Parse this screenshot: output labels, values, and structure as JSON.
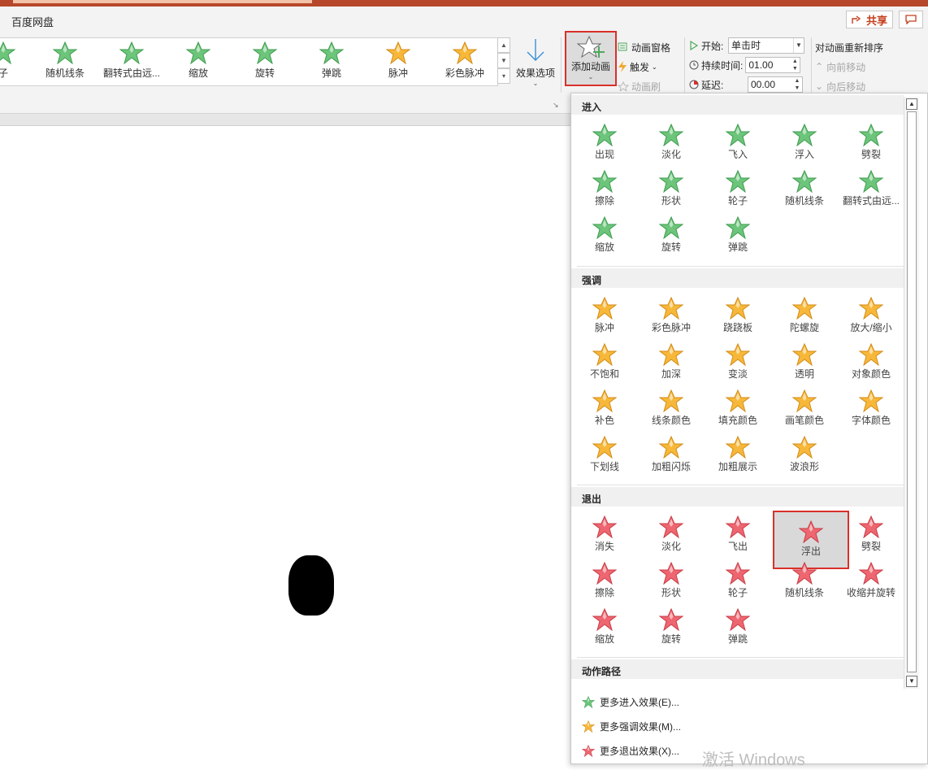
{
  "ribbon": {
    "tab_label": "百度网盘",
    "share_label": "共享",
    "gallery": [
      {
        "label": "子",
        "color": "green"
      },
      {
        "label": "随机线条",
        "color": "green"
      },
      {
        "label": "翻转式由远...",
        "color": "green"
      },
      {
        "label": "缩放",
        "color": "green"
      },
      {
        "label": "旋转",
        "color": "green"
      },
      {
        "label": "弹跳",
        "color": "green"
      },
      {
        "label": "脉冲",
        "color": "gold"
      },
      {
        "label": "彩色脉冲",
        "color": "gold"
      }
    ],
    "effect_options_label": "效果选项",
    "add_animation_label": "添加动画",
    "animation_pane_label": "动画窗格",
    "trigger_label": "触发",
    "anim_painter_label": "动画刷",
    "start_label": "开始:",
    "start_value": "单击时",
    "duration_label": "持续时间:",
    "duration_value": "01.00",
    "delay_label": "延迟:",
    "delay_value": "00.00",
    "reorder_label": "对动画重新排序",
    "move_earlier_label": "向前移动",
    "move_later_label": "向后移动"
  },
  "dropdown": {
    "sections": [
      {
        "title": "进入",
        "color": "#4eaa5c",
        "items": [
          "出现",
          "淡化",
          "飞入",
          "浮入",
          "劈裂",
          "擦除",
          "形状",
          "轮子",
          "随机线条",
          "翻转式由远...",
          "缩放",
          "旋转",
          "弹跳"
        ]
      },
      {
        "title": "强调",
        "color": "#f0a830",
        "items": [
          "脉冲",
          "彩色脉冲",
          "跷跷板",
          "陀螺旋",
          "放大/缩小",
          "不饱和",
          "加深",
          "变淡",
          "透明",
          "对象颜色",
          "补色",
          "线条颜色",
          "填充颜色",
          "画笔颜色",
          "字体颜色",
          "下划线",
          "加粗闪烁",
          "加粗展示",
          "波浪形"
        ]
      },
      {
        "title": "退出",
        "color": "#e0414b",
        "items": [
          "消失",
          "淡化",
          "飞出",
          "浮出",
          "劈裂",
          "擦除",
          "形状",
          "轮子",
          "随机线条",
          "收缩并旋转",
          "缩放",
          "旋转",
          "弹跳"
        ]
      },
      {
        "title": "动作路径",
        "items": []
      }
    ],
    "selected_item": "浮出",
    "more_links": [
      "更多进入效果(E)...",
      "更多强调效果(M)...",
      "更多退出效果(X)..."
    ]
  },
  "watermark": "激活 Windows"
}
